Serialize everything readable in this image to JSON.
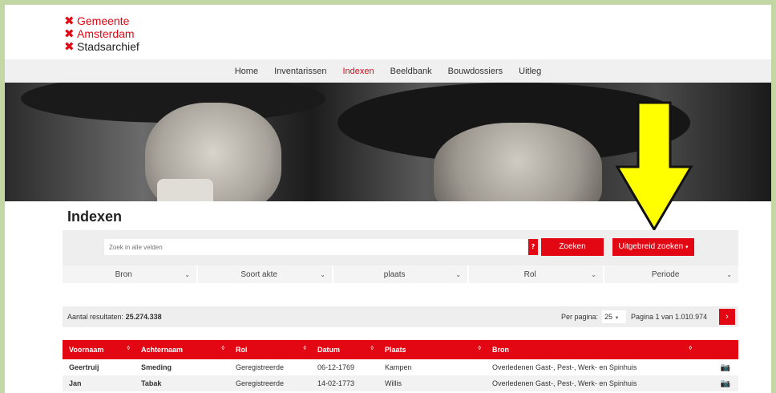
{
  "logo": {
    "line1": "Gemeente",
    "line2": "Amsterdam",
    "line3": "Stadsarchief"
  },
  "nav": [
    "Home",
    "Inventarissen",
    "Indexen",
    "Beeldbank",
    "Bouwdossiers",
    "Uitleg"
  ],
  "nav_active": "Indexen",
  "page_title": "Indexen",
  "search": {
    "placeholder": "Zoek in alle velden",
    "help_label": "?",
    "search_label": "Zoeken",
    "advanced_label": "Uitgebreid zoeken"
  },
  "filters": [
    "Bron",
    "Soort akte",
    "plaats",
    "Rol",
    "Periode"
  ],
  "results": {
    "label": "Aantal resultaten:",
    "count": "25.274.338",
    "per_page_label": "Per pagina:",
    "per_page_value": "25",
    "page_info": "Pagina 1 van 1.010.974",
    "next_label": "›"
  },
  "table": {
    "headers": [
      "Voornaam",
      "Achternaam",
      "Rol",
      "Datum",
      "Plaats",
      "Bron",
      ""
    ],
    "rows": [
      [
        "Geertruij",
        "Smeding",
        "Geregistreerde",
        "06-12-1769",
        "Kampen",
        "Overledenen Gast-, Pest-, Werk- en Spinhuis"
      ],
      [
        "Jan",
        "Tabak",
        "Geregistreerde",
        "14-02-1773",
        "Willis",
        "Overledenen Gast-, Pest-, Werk- en Spinhuis"
      ]
    ]
  },
  "colors": {
    "accent": "#e30613",
    "arrow": "#ffff00",
    "frame": "#c3d7a5"
  }
}
